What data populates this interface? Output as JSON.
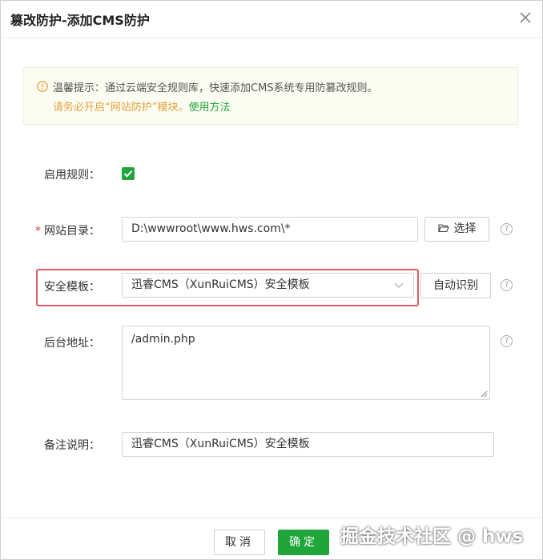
{
  "dialog": {
    "title": "篡改防护-添加CMS防护"
  },
  "tip": {
    "line1": "温馨提示：通过云端安全规则库，快速添加CMS系统专用防篡改规则。",
    "line2_prefix": "请务必开启“网站防护”模块。",
    "line2_link": "使用方法"
  },
  "form": {
    "enable_rule": {
      "label": "启用规则：",
      "checked": true
    },
    "site_dir": {
      "label": "网站目录：",
      "value": "D:\\wwwroot\\www.hws.com\\*",
      "select_button": "选择"
    },
    "security_template": {
      "label": "安全模板：",
      "value": "迅睿CMS（XunRuiCMS）安全模板",
      "auto_detect_button": "自动识别"
    },
    "admin_url": {
      "label": "后台地址：",
      "value": "/admin.php"
    },
    "remark": {
      "label": "备注说明：",
      "value": "迅睿CMS（XunRuiCMS）安全模板"
    }
  },
  "footer": {
    "cancel": "取消",
    "confirm": "确定"
  },
  "watermark": "掘金技术社区 @ hws",
  "colors": {
    "accent": "#20a53a",
    "warning": "#e6a23c",
    "highlight": "#e05a6a"
  }
}
